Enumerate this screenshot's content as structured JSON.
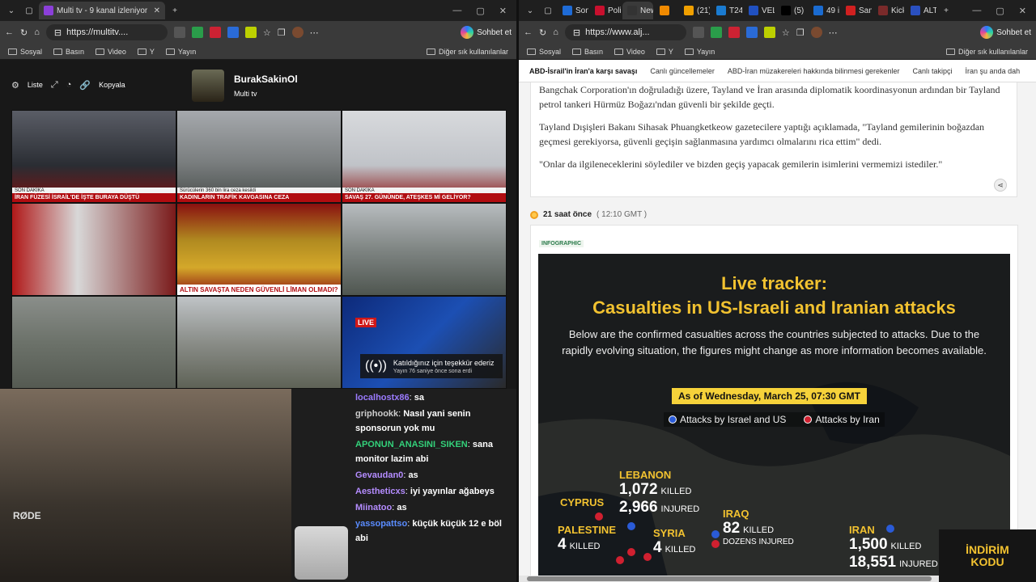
{
  "left_window": {
    "tab": {
      "title": "Multi tv - 9 kanal izleniyor"
    },
    "url": "https://multitv....",
    "copilot": "Sohbet et",
    "bookmarks": [
      "Sosyal",
      "Basın",
      "Video",
      "Y",
      "Yayın"
    ],
    "bookmarks_other": "Diğer sık kullanılanlar",
    "toolbar": {
      "list": "Liste",
      "copy": "Kopyala"
    },
    "channel": {
      "name": "BurakSakinOl",
      "subtitle": "Multi tv"
    },
    "tiles": [
      {
        "caption": "İRAN FÜZESİ İSRAİL'DE İŞTE BURAYA DÜŞTÜ",
        "ticker": "SON DAKİKA"
      },
      {
        "caption": "KADINLARIN TRAFİK KAVGASINA CEZA",
        "ticker": "Sürücülerin 360 bin lira ceza kesildi"
      },
      {
        "caption": "SAVAŞ 27. GÜNÜNDE, ATEŞKES Mİ GELİYOR?",
        "ticker": "SON DAKİKA"
      },
      {
        "caption": "",
        "ticker": ""
      },
      {
        "caption": "ALTIN SAVAŞTA NEDEN GÜVENLİ LİMAN OLMADI?",
        "ticker": ""
      },
      {
        "caption": "",
        "ticker": ""
      },
      {
        "caption": "",
        "ticker": ""
      },
      {
        "caption": "",
        "ticker": ""
      },
      {
        "caption": "",
        "ticker": ""
      }
    ],
    "endcard": {
      "title": "Katıldığınız için teşekkür ederiz",
      "subtitle": "Yayın 76 saniye önce sona erdi",
      "live": "LIVE"
    },
    "chat": [
      {
        "user": "localhostx86",
        "msg": "sa",
        "color": "#9b7bff"
      },
      {
        "user": "griphookk",
        "msg": "Nasıl yani senin sponsorun yok mu",
        "color": "#cccccc"
      },
      {
        "user": "APONUN_ANASINI_SIKEN",
        "msg": "sana monitor lazim abi",
        "color": "#33d17a"
      },
      {
        "user": "Gevaudan0",
        "msg": "as",
        "color": "#b48cff"
      },
      {
        "user": "Aestheticxs",
        "msg": "iyi yayınlar ağabeys",
        "color": "#b48cff"
      },
      {
        "user": "Miinatoo",
        "msg": "as",
        "color": "#b48cff"
      },
      {
        "user": "yassopattso",
        "msg": "küçük küçük 12 e böl abi",
        "color": "#5a8cff"
      }
    ],
    "cam_label": "RØDE"
  },
  "right_window": {
    "tabs": [
      "Son",
      "Poli",
      "New",
      "",
      "(21)",
      "T24",
      "VEL",
      "(5)",
      "49 i",
      "Sam",
      "Kick",
      "ALT"
    ],
    "url": "https://www.alj...",
    "copilot": "Sohbet et",
    "bookmarks": [
      "Sosyal",
      "Basın",
      "Video",
      "Y",
      "Yayın"
    ],
    "bookmarks_other": "Diğer sık kullanılanlar",
    "nav": [
      "ABD-İsrail'in İran'a karşı savaşı",
      "Canlı güncellemeler",
      "ABD-İran müzakereleri hakkında bilinmesi gerekenler",
      "Canlı takipçi",
      "İran şu anda dah"
    ],
    "article": [
      "Bangchak Corporation'ın doğruladığı üzere, Tayland ve İran arasında diplomatik koordinasyonun ardından bir Tayland petrol tankeri Hürmüz Boğazı'ndan güvenli bir şekilde geçti.",
      "Tayland Dışişleri Bakanı Sihasak Phuangketkeow gazetecilere yaptığı açıklamada, \"Tayland gemilerinin boğazdan geçmesi gerekiyorsa, güvenli geçişin sağlanmasına yardımcı olmalarını rica ettim\" dedi.",
      "\"Onlar da ilgileneceklerini söylediler ve bizden geçiş yapacak gemilerin isimlerini vermemizi istediler.\""
    ],
    "timeline": {
      "ago": "21 saat önce",
      "gmt": "( 12:10 GMT )"
    },
    "infographic_label": "INFOGRAPHIC",
    "infographic": {
      "title1": "Live tracker:",
      "title2": "Casualties in US-Israeli and Iranian attacks",
      "subtitle": "Below are the confirmed casualties across the countries subjected to attacks. Due to the rapidly evolving situation, the figures might change as more information becomes available.",
      "asof": "As of Wednesday, March 25, 07:30 GMT",
      "legend_us": "Attacks by Israel and US",
      "legend_iran": "Attacks by Iran",
      "lebanon": {
        "name": "LEBANON",
        "killed": "1,072",
        "killed_unit": "KILLED",
        "injured": "2,966",
        "injured_unit": "INJURED"
      },
      "cyprus": {
        "name": "CYPRUS"
      },
      "palestine": {
        "name": "PALESTINE",
        "killed": "4",
        "killed_unit": "KILLED"
      },
      "syria": {
        "name": "SYRIA",
        "killed": "4",
        "killed_unit": "KILLED"
      },
      "iraq": {
        "name": "IRAQ",
        "killed": "82",
        "killed_unit": "KILLED",
        "injured": "DOZENS INJURED"
      },
      "iran": {
        "name": "IRAN",
        "killed": "1,500",
        "killed_unit": "KILLED",
        "injured": "18,551",
        "injured_unit": "INJURED"
      }
    },
    "promo": {
      "line1": "İNDİRİM",
      "line2": "KODU"
    },
    "colors": {
      "us": "#2a5bd7",
      "iran": "#d02030",
      "accent": "#f2c230"
    }
  }
}
